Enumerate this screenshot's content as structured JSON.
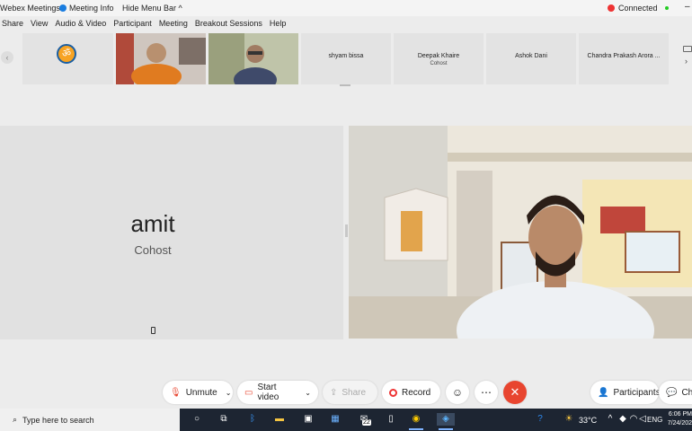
{
  "titlebar": {
    "app_title": "Webex Meetings",
    "meeting_info": "Meeting Info",
    "hide_menu": "Hide Menu Bar ^",
    "status": "Connected"
  },
  "menu": [
    "Share",
    "View",
    "Audio & Video",
    "Participant",
    "Meeting",
    "Breakout Sessions",
    "Help"
  ],
  "thumbnails": [
    {
      "name": "",
      "sub": ""
    },
    {
      "name": "",
      "sub": ""
    },
    {
      "name": "",
      "sub": ""
    },
    {
      "name": "shyam bissa",
      "sub": ""
    },
    {
      "name": "Deepak Khaire",
      "sub": "Cohost"
    },
    {
      "name": "Ashok Dani",
      "sub": ""
    },
    {
      "name": "Chandra Prakash Arora ...",
      "sub": ""
    }
  ],
  "stage": {
    "amit_name": "amit",
    "amit_role": "Cohost"
  },
  "controls": {
    "unmute": "Unmute",
    "start_video": "Start video",
    "share": "Share",
    "record": "Record",
    "participants": "Participants",
    "chat": "Chat"
  },
  "taskbar": {
    "search_placeholder": "Type here to search",
    "weather": "33°C",
    "lang": "ENG",
    "time": "6:06 PM",
    "date": "7/24/202",
    "badge": "22"
  },
  "colors": {
    "end_button": "#e8452f",
    "taskbar": "#1d2532",
    "record_dot": "#e33"
  }
}
